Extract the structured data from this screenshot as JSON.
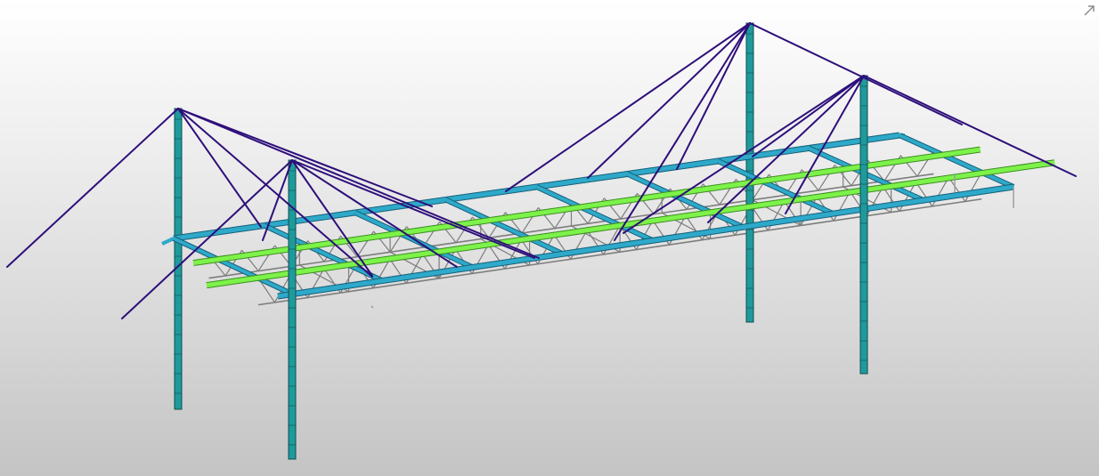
{
  "viewport": {
    "expand_icon": "expand-diagonal-arrow-icon"
  },
  "colors": {
    "pylon_fill": "#1f9a9c",
    "pylon_edge": "#0f4e50",
    "cable": "#2e0f7a",
    "deck_beam": "#2ea9c9",
    "deck_beam_edge": "#15607a",
    "stringer": "#7df24a",
    "stringer_edge": "#3a8f1e",
    "truss": "#7d7d7d",
    "background_top": "#ffffff",
    "background_bottom": "#c4c4c4"
  }
}
